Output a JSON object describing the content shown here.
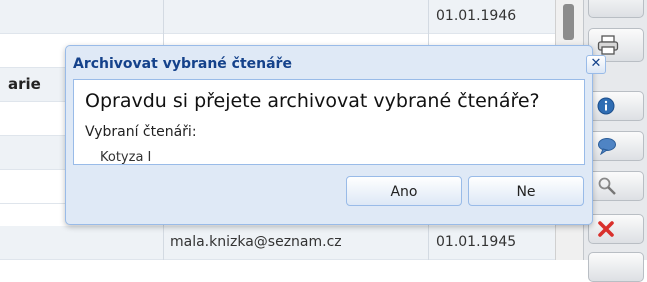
{
  "table": {
    "row_top_date": "01.01.1946",
    "row_label": "arie",
    "row_bottom_email": "mala.knizka@seznam.cz",
    "row_bottom_date": "01.01.1945"
  },
  "dialog": {
    "title": "Archivovat vybrané čtenáře",
    "close_label": "✕",
    "question": "Opravdu si přejete archivovat vybrané čtenáře?",
    "selected_label": "Vybraní čtenáři:",
    "selected_value": "Kotyza I",
    "buttons": {
      "yes": "Ano",
      "no": "Ne"
    }
  },
  "toolbar": {
    "icons": [
      "printer-icon",
      "info-icon",
      "comment-icon",
      "search-icon",
      "delete-icon"
    ]
  },
  "colors": {
    "dialog_title": "#15428b",
    "dialog_border": "#99bbe8",
    "delete_red": "#d9302c",
    "info_blue": "#2f6db3"
  }
}
